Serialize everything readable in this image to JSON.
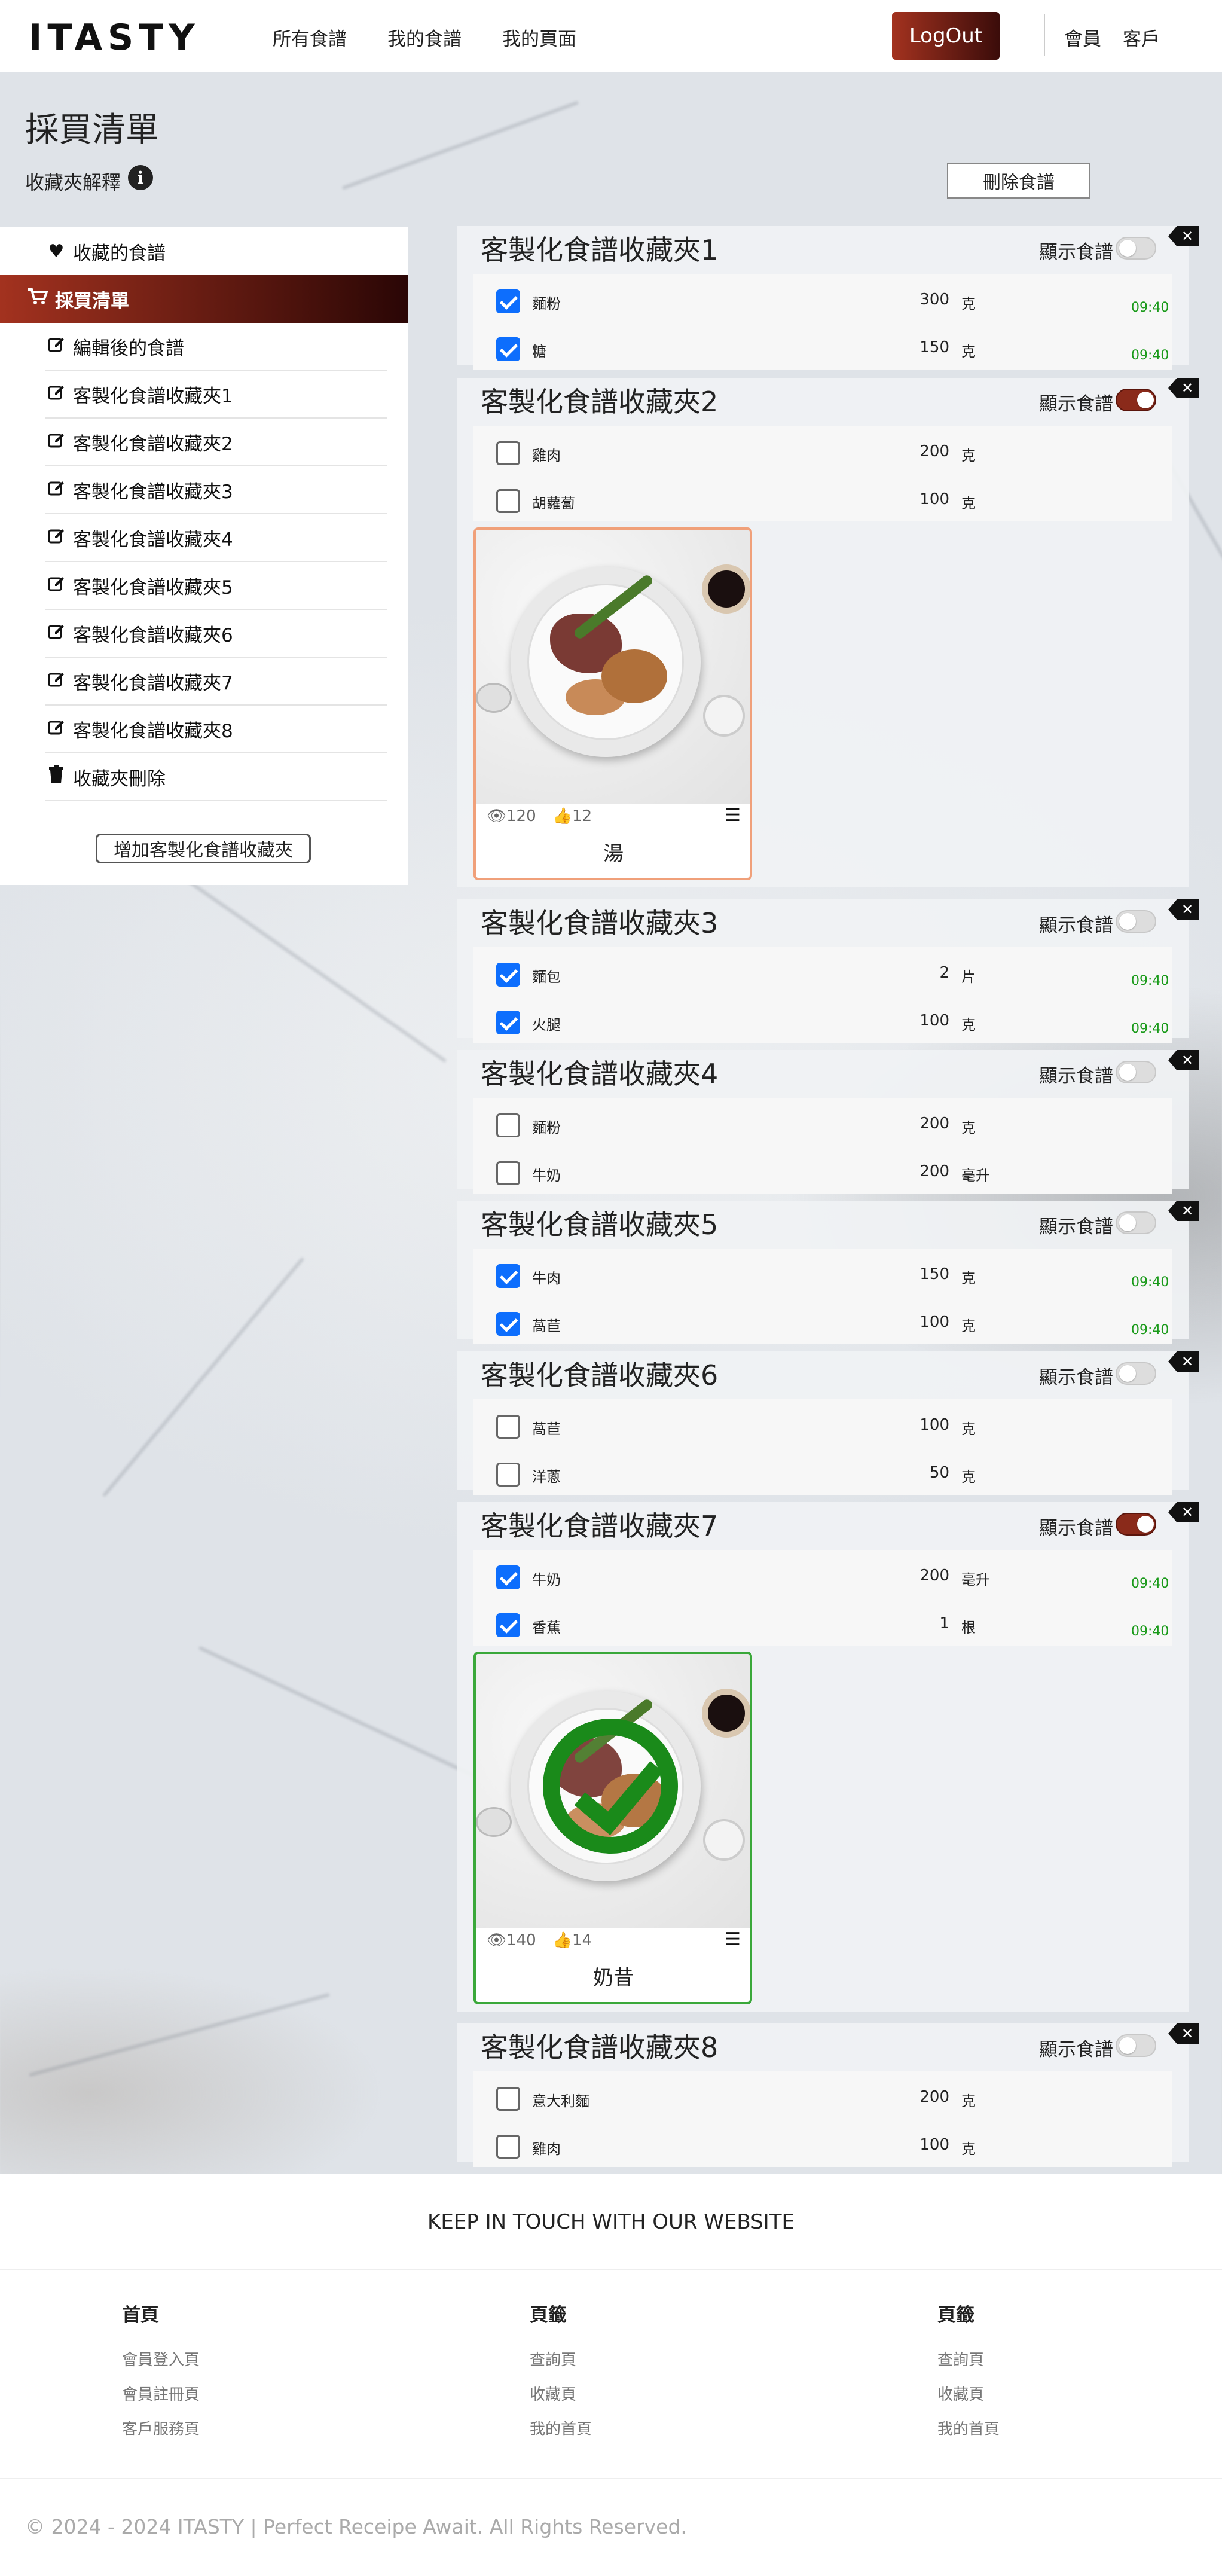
{
  "header": {
    "logo": "ITASTY",
    "nav": [
      "所有食譜",
      "我的食譜",
      "我的頁面"
    ],
    "logout": "LogOut",
    "right_links": [
      "會員",
      "客戶"
    ]
  },
  "page": {
    "title": "採買清單",
    "folder_explain": "收藏夾解釋",
    "info_icon": "i",
    "delete_recipe": "刪除食譜"
  },
  "sidebar": {
    "favorites": "收藏的食譜",
    "shopping_list": "採買清單",
    "items": [
      "編輯後的食譜",
      "客製化食譜收藏夾1",
      "客製化食譜收藏夾2",
      "客製化食譜收藏夾3",
      "客製化食譜收藏夾4",
      "客製化食譜收藏夾5",
      "客製化食譜收藏夾6",
      "客製化食譜收藏夾7",
      "客製化食譜收藏夾8"
    ],
    "delete_folder": "收藏夾刪除",
    "add_folder": "增加客製化食譜收藏夾"
  },
  "show_recipe_label": "顯示食譜",
  "folders": [
    {
      "title": "客製化食譜收藏夾1",
      "toggle_on": false,
      "items": [
        {
          "name": "麵粉",
          "qty": "300",
          "unit": "克",
          "checked": true,
          "time": "09:40"
        },
        {
          "name": "糖",
          "qty": "150",
          "unit": "克",
          "checked": true,
          "time": "09:40"
        }
      ]
    },
    {
      "title": "客製化食譜收藏夾2",
      "toggle_on": true,
      "items": [
        {
          "name": "雞肉",
          "qty": "200",
          "unit": "克",
          "checked": false,
          "time": ""
        },
        {
          "name": "胡蘿蔔",
          "qty": "100",
          "unit": "克",
          "checked": false,
          "time": ""
        }
      ],
      "card": {
        "views": "120",
        "likes": "12",
        "name": "湯",
        "done": false
      }
    },
    {
      "title": "客製化食譜收藏夾3",
      "toggle_on": false,
      "items": [
        {
          "name": "麵包",
          "qty": "2",
          "unit": "片",
          "checked": true,
          "time": "09:40"
        },
        {
          "name": "火腿",
          "qty": "100",
          "unit": "克",
          "checked": true,
          "time": "09:40"
        }
      ]
    },
    {
      "title": "客製化食譜收藏夾4",
      "toggle_on": false,
      "items": [
        {
          "name": "麵粉",
          "qty": "200",
          "unit": "克",
          "checked": false,
          "time": ""
        },
        {
          "name": "牛奶",
          "qty": "200",
          "unit": "毫升",
          "checked": false,
          "time": ""
        }
      ]
    },
    {
      "title": "客製化食譜收藏夾5",
      "toggle_on": false,
      "items": [
        {
          "name": "牛肉",
          "qty": "150",
          "unit": "克",
          "checked": true,
          "time": "09:40"
        },
        {
          "name": "萵苣",
          "qty": "100",
          "unit": "克",
          "checked": true,
          "time": "09:40"
        }
      ]
    },
    {
      "title": "客製化食譜收藏夾6",
      "toggle_on": false,
      "items": [
        {
          "name": "萵苣",
          "qty": "100",
          "unit": "克",
          "checked": false,
          "time": ""
        },
        {
          "name": "洋蔥",
          "qty": "50",
          "unit": "克",
          "checked": false,
          "time": ""
        }
      ]
    },
    {
      "title": "客製化食譜收藏夾7",
      "toggle_on": true,
      "items": [
        {
          "name": "牛奶",
          "qty": "200",
          "unit": "毫升",
          "checked": true,
          "time": "09:40"
        },
        {
          "name": "香蕉",
          "qty": "1",
          "unit": "根",
          "checked": true,
          "time": "09:40"
        }
      ],
      "card": {
        "views": "140",
        "likes": "14",
        "name": "奶昔",
        "done": true
      }
    },
    {
      "title": "客製化食譜收藏夾8",
      "toggle_on": false,
      "items": [
        {
          "name": "意大利麵",
          "qty": "200",
          "unit": "克",
          "checked": false,
          "time": ""
        },
        {
          "name": "雞肉",
          "qty": "100",
          "unit": "克",
          "checked": false,
          "time": ""
        }
      ]
    }
  ],
  "footer": {
    "keep_in_touch": "KEEP IN TOUCH WITH OUR WEBSITE",
    "columns": [
      {
        "title": "首頁",
        "links": [
          "會員登入頁",
          "會員註冊頁",
          "客戶服務頁"
        ]
      },
      {
        "title": "頁籤",
        "links": [
          "查詢頁",
          "收藏頁",
          "我的首頁"
        ]
      },
      {
        "title": "頁籤",
        "links": [
          "查詢頁",
          "收藏頁",
          "我的首頁"
        ]
      }
    ],
    "copyright": "© 2024 - 2024 ITASTY | Perfect Receipe Await. All Rights Reserved."
  },
  "icons": {
    "favorites": "heart-icon",
    "shopping": "cart-icon",
    "edit": "edit-icon",
    "trash": "trash-icon",
    "close": "close-icon",
    "eye": "eye-icon",
    "thumb": "thumbs-up-icon",
    "list": "list-check-icon",
    "info": "info-icon"
  },
  "colors": {
    "brand_gradient_start": "#a3321f",
    "brand_gradient_end": "#2a0605",
    "checkbox": "#0d6efd",
    "time_green": "#1a9a1a",
    "card_border_orange": "#f0a07a",
    "card_border_green": "#3aa83a"
  }
}
